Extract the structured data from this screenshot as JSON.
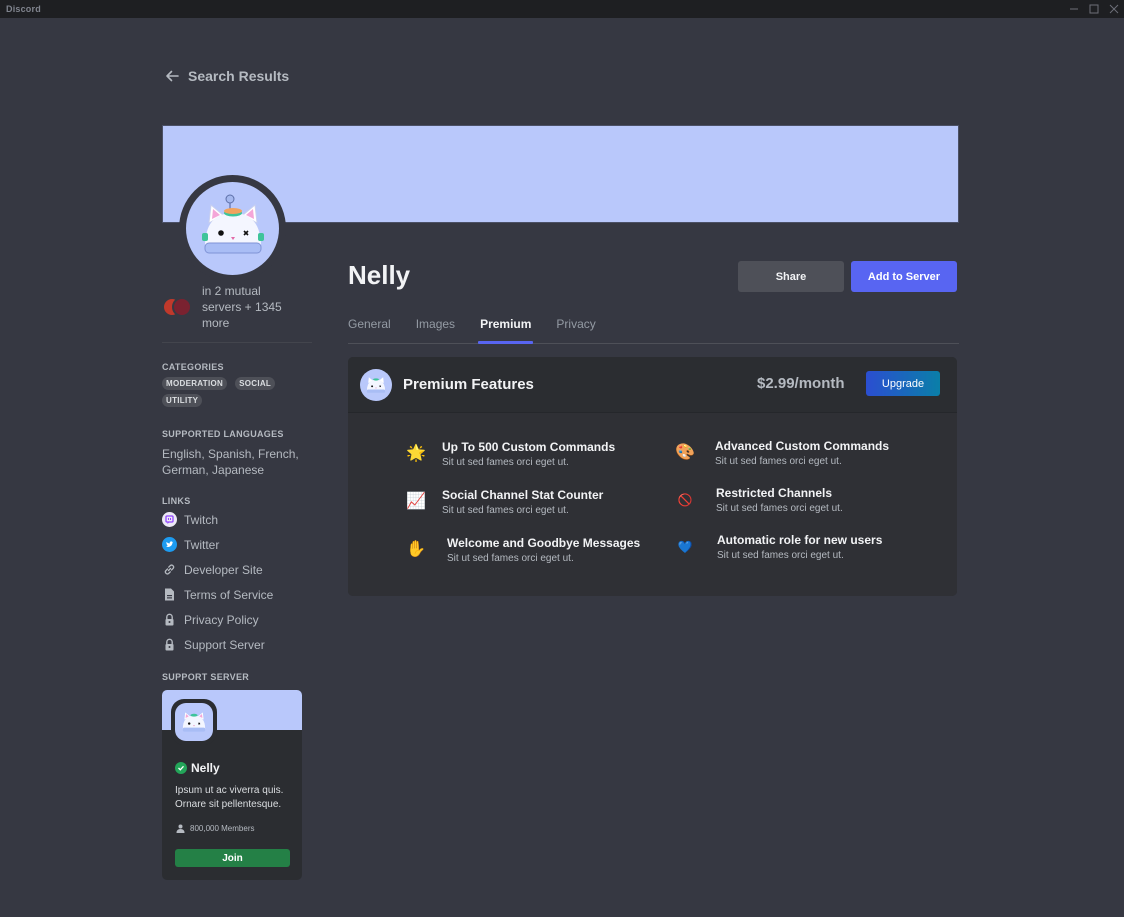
{
  "window": {
    "app_name": "Discord",
    "controls": {
      "minimize": "—",
      "maximize": "☐",
      "close": "✕"
    }
  },
  "nav": {
    "back_label": "Search Results"
  },
  "bot": {
    "name": "Nelly",
    "mutual_text": "in 2 mutual servers + 1345 more"
  },
  "sidebar": {
    "categories_title": "CATEGORIES",
    "categories": [
      "MODERATION",
      "SOCIAL",
      "UTILITY"
    ],
    "languages_title": "SUPPORTED LANGUAGES",
    "languages": "English, Spanish, French, German, Japanese",
    "links_title": "LINKS",
    "links": [
      {
        "label": "Twitch",
        "icon": "twitch-icon"
      },
      {
        "label": "Twitter",
        "icon": "twitter-icon"
      },
      {
        "label": "Developer Site",
        "icon": "link-icon"
      },
      {
        "label": "Terms of Service",
        "icon": "document-icon"
      },
      {
        "label": "Privacy Policy",
        "icon": "lock-icon"
      },
      {
        "label": "Support Server",
        "icon": "lock-icon"
      }
    ],
    "support_title": "SUPPORT SERVER",
    "support_server": {
      "name": "Nelly",
      "description": "Ipsum ut ac viverra quis. Ornare sit pellentesque.",
      "members": "800,000 Members",
      "join_label": "Join"
    }
  },
  "actions": {
    "share_label": "Share",
    "add_label": "Add to Server"
  },
  "tabs": [
    {
      "label": "General",
      "active": false
    },
    {
      "label": "Images",
      "active": false
    },
    {
      "label": "Premium",
      "active": true
    },
    {
      "label": "Privacy",
      "active": false
    }
  ],
  "premium": {
    "title": "Premium Features",
    "price": "$2.99/month",
    "upgrade_label": "Upgrade",
    "features": [
      {
        "emoji": "🌟",
        "icon": "glowing-star-icon",
        "title": "Up To 500 Custom Commands",
        "desc": "Sit ut sed fames orci eget ut."
      },
      {
        "emoji": "🎨",
        "icon": "palette-icon",
        "title": "Advanced Custom Commands",
        "desc": "Sit ut sed fames orci eget ut."
      },
      {
        "emoji": "📈",
        "icon": "chart-increasing-icon",
        "title": "Social Channel Stat Counter",
        "desc": "Sit ut sed fames orci eget ut."
      },
      {
        "emoji": "🚫",
        "icon": "prohibited-icon",
        "title": "Restricted Channels",
        "desc": "Sit ut sed fames orci eget ut."
      },
      {
        "emoji": "✋",
        "icon": "raised-hand-icon",
        "title": "Welcome and Goodbye Messages",
        "desc": "Sit ut sed fames orci eget ut."
      },
      {
        "emoji": "💙",
        "icon": "blue-heart-icon",
        "title": "Automatic role for new users",
        "desc": "Sit ut sed fames orci eget ut."
      }
    ]
  },
  "colors": {
    "background": "#363842",
    "banner": "#b9c8fb",
    "accent": "#5865f2",
    "join_green": "#248046",
    "verified_green": "#23a559"
  }
}
